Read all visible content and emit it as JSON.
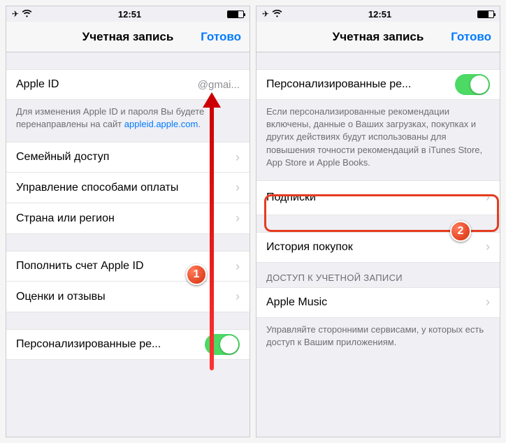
{
  "statusbar": {
    "time": "12:51"
  },
  "nav": {
    "title": "Учетная запись",
    "done": "Готово"
  },
  "left": {
    "apple_id_label": "Apple ID",
    "apple_id_value": "@gmai...",
    "footer1a": "Для изменения Apple ID и пароля Вы будете перенаправлены на сайт ",
    "footer1b": "appleid.apple.com",
    "footer1c": ".",
    "family": "Семейный доступ",
    "payment": "Управление способами оплаты",
    "country": "Страна или регион",
    "topup": "Пополнить счет Apple ID",
    "reviews": "Оценки и отзывы",
    "personalized": "Персонализированные ре..."
  },
  "right": {
    "personalized": "Персонализированные ре...",
    "rec_footer": "Если персонализированные рекомендации включены, данные о Ваших загрузках, покупках и других действиях будут использованы для повышения точности рекомендаций в iTunes Store, App Store и Apple Books.",
    "subscriptions": "Подписки",
    "history": "История покупок",
    "access_header": "ДОСТУП К УЧЕТНОЙ ЗАПИСИ",
    "apple_music": "Apple Music",
    "access_footer": "Управляйте сторонними сервисами, у которых есть доступ к Вашим приложениям."
  }
}
